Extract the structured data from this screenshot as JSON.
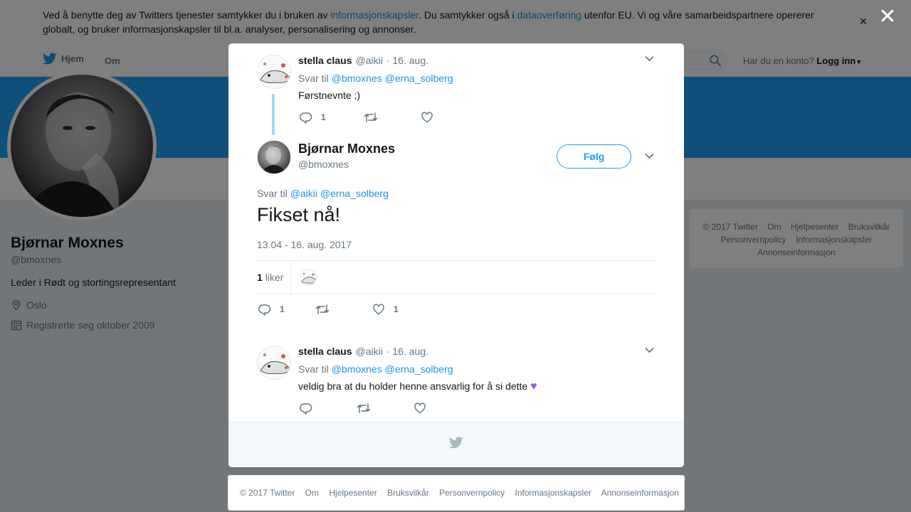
{
  "cookie_bar": {
    "text_1": "Ved å benytte deg av Twitters tjenester samtykker du i bruken av ",
    "link_1": "informasjonskapsler",
    "text_2": ". Du samtykker også i ",
    "link_2": "dataoverføring",
    "text_3": " utenfor EU. Vi og våre samarbeidspartnere opererer globalt, og bruker informasjonskapsler til bl.a. analyser, personalisering og annonser.",
    "close": "×"
  },
  "nav": {
    "home": "Hjem",
    "about": "Om",
    "account_q": "Har du en konto?",
    "login": "Logg inn"
  },
  "profile": {
    "name": "Bjørnar Moxnes",
    "handle": "@bmoxnes",
    "bio": "Leder i Rødt og stortingsrepresentant",
    "location": "Oslo",
    "joined": "Registrerte seg oktober 2009"
  },
  "side_footer": [
    "© 2017 Twitter",
    "Om",
    "Hjelpesenter",
    "Bruksvilkår",
    "Personvernpolicy",
    "Informasjonskapsler",
    "Annonseinformasjon"
  ],
  "overlay_close": "✕",
  "tweet_parent": {
    "name": "stella claus",
    "handle": "@aikii",
    "date": "· 16. aug.",
    "reply_prefix": "Svar til",
    "reply_1": "@bmoxnes",
    "reply_2": "@erna_solberg",
    "text": "Førstnevnte ;)",
    "reply_count": "1"
  },
  "main_tweet": {
    "name": "Bjørnar Moxnes",
    "handle": "@bmoxnes",
    "follow": "Følg",
    "reply_prefix": "Svar til",
    "reply_1": "@aikii",
    "reply_2": "@erna_solberg",
    "text": "Fikset nå!",
    "timestamp": "13.04 - 16. aug. 2017",
    "likes_count": "1",
    "likes_label": "liker",
    "reply_count": "1",
    "like_count": "1"
  },
  "tweet_reply": {
    "name": "stella claus",
    "handle": "@aikii",
    "date": "· 16. aug.",
    "reply_prefix": "Svar til",
    "reply_1": "@bmoxnes",
    "reply_2": "@erna_solberg",
    "text": "veldig bra at du holder henne ansvarlig for å si dette",
    "emoji": "💜"
  },
  "bottom_footer": [
    "© 2017 Twitter",
    "Om",
    "Hjelpesenter",
    "Bruksvilkår",
    "Personvernpolicy",
    "Informasjonskapsler",
    "Annonseinformasjon"
  ],
  "colors": {
    "brand": "#1da1f2",
    "link": "#1b95e0",
    "thread": "#a5d6f7",
    "heart_emoji": "#9b59d6"
  }
}
